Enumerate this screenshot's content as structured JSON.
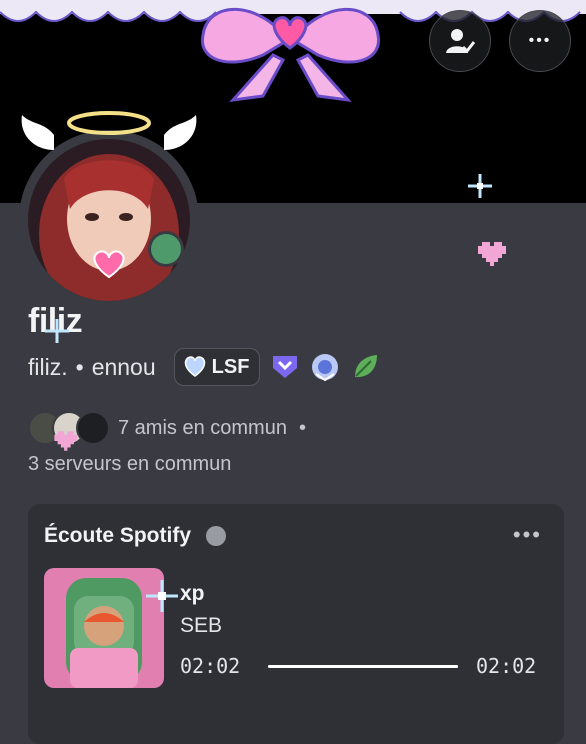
{
  "profile": {
    "display_name": "filiz",
    "username": "filiz.",
    "separator": "•",
    "pronouns": "ennou",
    "guild_tag": "LSF",
    "status": "online"
  },
  "mutual": {
    "friends": "7 amis en commun",
    "separator": "•",
    "servers": "3 serveurs en commun"
  },
  "spotify": {
    "heading": "Écoute Spotify",
    "more": "•••",
    "track": "xp",
    "artist": "SEB",
    "time_elapsed": "02:02",
    "time_total": "02:02",
    "progress": 1.0
  },
  "top_actions": {
    "more": "•••"
  },
  "icons": [
    "add-friend-icon",
    "more-icon",
    "spotify-icon",
    "heart-icon",
    "badge-icon",
    "laurel-icon",
    "leaf-icon"
  ],
  "colors": {
    "background": "#3a3b42",
    "banner": "#000000",
    "status_online": "#4e9a6a",
    "bow_pink": "#f49bdc",
    "bow_purple": "#7b5bd6"
  }
}
